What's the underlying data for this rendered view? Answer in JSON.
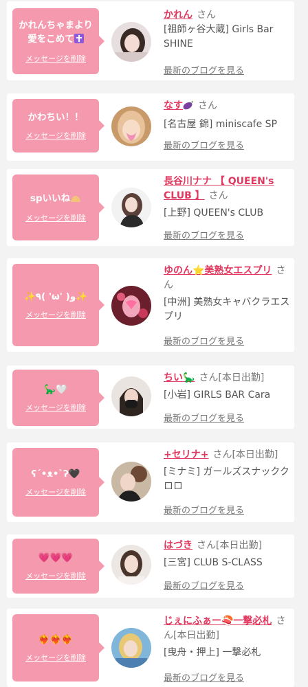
{
  "colors": {
    "accent": "#e0385f",
    "bubble": "#f59aae",
    "background": "#f3f3f3"
  },
  "common": {
    "delete_label": "メッセージを削除",
    "blog_label": "最新のブログを見る",
    "san": "さん"
  },
  "entries": [
    {
      "message": "かれんちゃまより\n愛をこめて",
      "message_icon": "cross-emoji-icon",
      "name": "かれん",
      "suffix": "さん",
      "shop": "[祖師ヶ谷大蔵] Girls Bar SHINE"
    },
    {
      "message": "かわちい！！",
      "name": "なす",
      "name_icon": "eggplant-emoji-icon",
      "suffix": "さん",
      "shop": "[名古屋 錦] miniscafe SP"
    },
    {
      "message": "spいいね",
      "message_icon": "hands-emoji-icon",
      "name": "長谷川ナナ 【 QUEEN's CLUB 】",
      "suffix": "さん",
      "shop": "[上野] QUEEN's CLUB"
    },
    {
      "message": "✨٩( 'ω' )و✨",
      "name": "ゆのん⭐美熟女エスプリ",
      "suffix": "さん",
      "shop": "[中洲] 美熟女キャバクラエスプリ"
    },
    {
      "message": "🦕🤍",
      "name": "ちい🦕",
      "suffix": "さん[本日出勤]",
      "shop": "[小岩] GIRLS BAR Cara"
    },
    {
      "message": "ʕ´•ᴥ•`ʔ🖤",
      "name": "+セリナ+",
      "suffix": "さん[本日出勤]",
      "shop": "[ミナミ] ガールズスナッククロロ"
    },
    {
      "message": "💗💗💗",
      "name": "はづき",
      "suffix": "さん[本日出勤]",
      "shop": "[三宮] CLUB S-CLASS"
    },
    {
      "message": "❤️‍🔥❤️‍🔥❤️‍🔥",
      "name": "じぇにふぁー🍣一撃必札",
      "suffix": "さん[本日出勤]",
      "shop": "[曳舟・押上] 一撃必札"
    }
  ]
}
